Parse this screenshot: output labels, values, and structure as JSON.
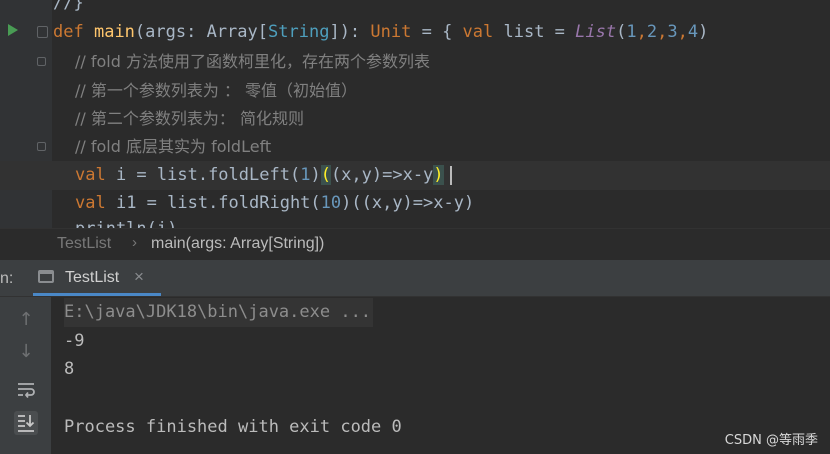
{
  "editor": {
    "partial_top": "//}",
    "main_sig": {
      "def": "def",
      "name": "main",
      "params_open": "(args: ",
      "array": "Array",
      "bracket_open": "[",
      "string_type": "String",
      "bracket_close": "]",
      "close_colon": "): ",
      "unit": "Unit",
      "eq_brace": " = { ",
      "val": "val",
      "list_name": " list = ",
      "list_call": "List",
      "paren_open": "(",
      "n1": "1",
      "n2": "2",
      "n3": "3",
      "n4": "4",
      "comma": ",",
      "paren_close": ")"
    },
    "comment1": "// fold 方法使用了函数柯里化，存在两个参数列表",
    "comment2": "// 第一个参数列表为 ： 零值（初始值）",
    "comment3": "// 第二个参数列表为： 简化规则",
    "comment4": "// fold 底层其实为 foldLeft",
    "line_i": {
      "val": "val",
      "rest_a": " i = list.foldLeft(",
      "num": "1",
      "rest_b": ")",
      "hl_open": "(",
      "middle": "(x,y)=>x-y",
      "hl_close": ")"
    },
    "line_i1": {
      "val": "val",
      "rest_a": " i1 = list.foldRight(",
      "num": "10",
      "rest_b": ")((x,y)=>x-y)"
    },
    "partial_bottom": "println(i)"
  },
  "breadcrumb": {
    "file": "TestList",
    "separator": "›",
    "method": "main(args: Array[String])"
  },
  "run_panel": {
    "label": "n:",
    "tab_label": "TestList",
    "tab_close": "×",
    "icons": [
      "arrow-up-icon",
      "arrow-down-icon",
      "soft-wrap-icon",
      "scroll-to-end-icon"
    ],
    "output": {
      "command": "E:\\java\\JDK18\\bin\\java.exe ...",
      "line1": "-9",
      "line2": "8",
      "blank": "",
      "exit": "Process finished with exit code 0"
    }
  },
  "watermark": "CSDN @等雨季",
  "colors": {
    "editor_bg": "#2b2b2b",
    "keyword": "#cc7832",
    "function": "#ffc66d",
    "number": "#6897bb",
    "comment": "#808080",
    "brace_highlight": "#ffef28"
  }
}
